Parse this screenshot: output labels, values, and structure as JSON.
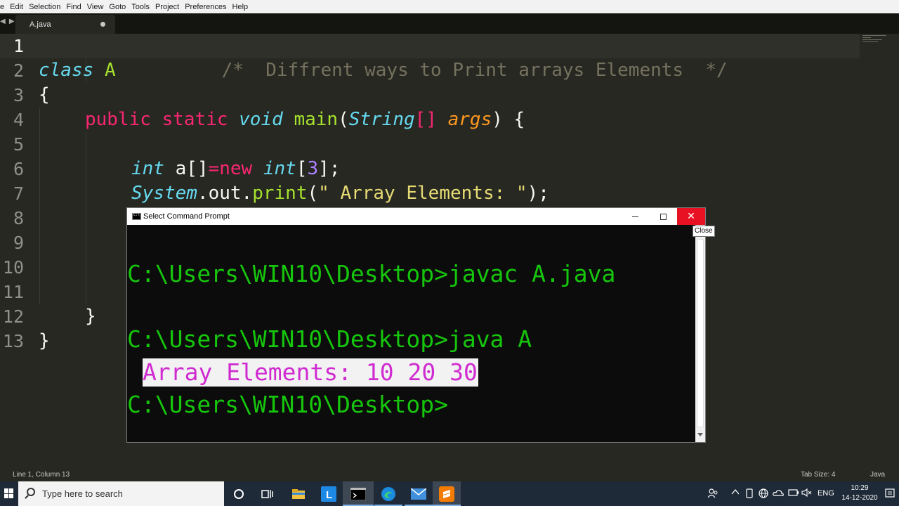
{
  "menubar": {
    "items": [
      "e",
      "Edit",
      "Selection",
      "Find",
      "View",
      "Goto",
      "Tools",
      "Project",
      "Preferences",
      "Help"
    ]
  },
  "tabs": {
    "arrows": "◀ ▶",
    "active": {
      "label": "A.java",
      "dirty": true
    }
  },
  "editor": {
    "line_numbers": [
      "1",
      "2",
      "3",
      "4",
      "5",
      "6",
      "7",
      "8",
      "9",
      "10",
      "11",
      "12",
      "13"
    ],
    "lines": {
      "l1": {
        "comment": "/*  Diffrent ways to Print arrays Elements  */"
      },
      "l2": {
        "kw": "class",
        "name": "A"
      },
      "l3": {
        "brace": "{"
      },
      "l4": {
        "public": "public",
        "static": "static",
        "void": "void",
        "main": "main",
        "paren_open": "(",
        "type": "String",
        "brackets": "[]",
        "arg": "args",
        "paren_close": ") {"
      },
      "l6": {
        "type": "int",
        "var": " a[]",
        "eq": "=",
        "new": "new",
        "type2": "int",
        "lb": "[",
        "num": "3",
        "rb": "];"
      },
      "l7": {
        "obj": "System",
        "call": ".out.",
        "method": "print",
        "open": "(",
        "str": "\" Array Elements: \"",
        "close": ");"
      },
      "l12": {
        "brace": "}"
      },
      "l13": {
        "brace": "}"
      }
    }
  },
  "statusbar": {
    "position": "Line 1, Column 13",
    "tab_size": "Tab Size: 4",
    "syntax": "Java"
  },
  "cmd": {
    "title": "Select Command Prompt",
    "tooltip": "Close",
    "close_glyph": "✕",
    "lines": {
      "l1": "C:\\Users\\WIN10\\Desktop>javac A.java",
      "l2": "C:\\Users\\WIN10\\Desktop>java A",
      "l3": "Array Elements: 10 20 30",
      "l4": "C:\\Users\\WIN10\\Desktop>"
    }
  },
  "taskbar": {
    "search_placeholder": "Type here to search",
    "ime": "ENG",
    "time": "10:29",
    "date": "14-12-2020"
  }
}
